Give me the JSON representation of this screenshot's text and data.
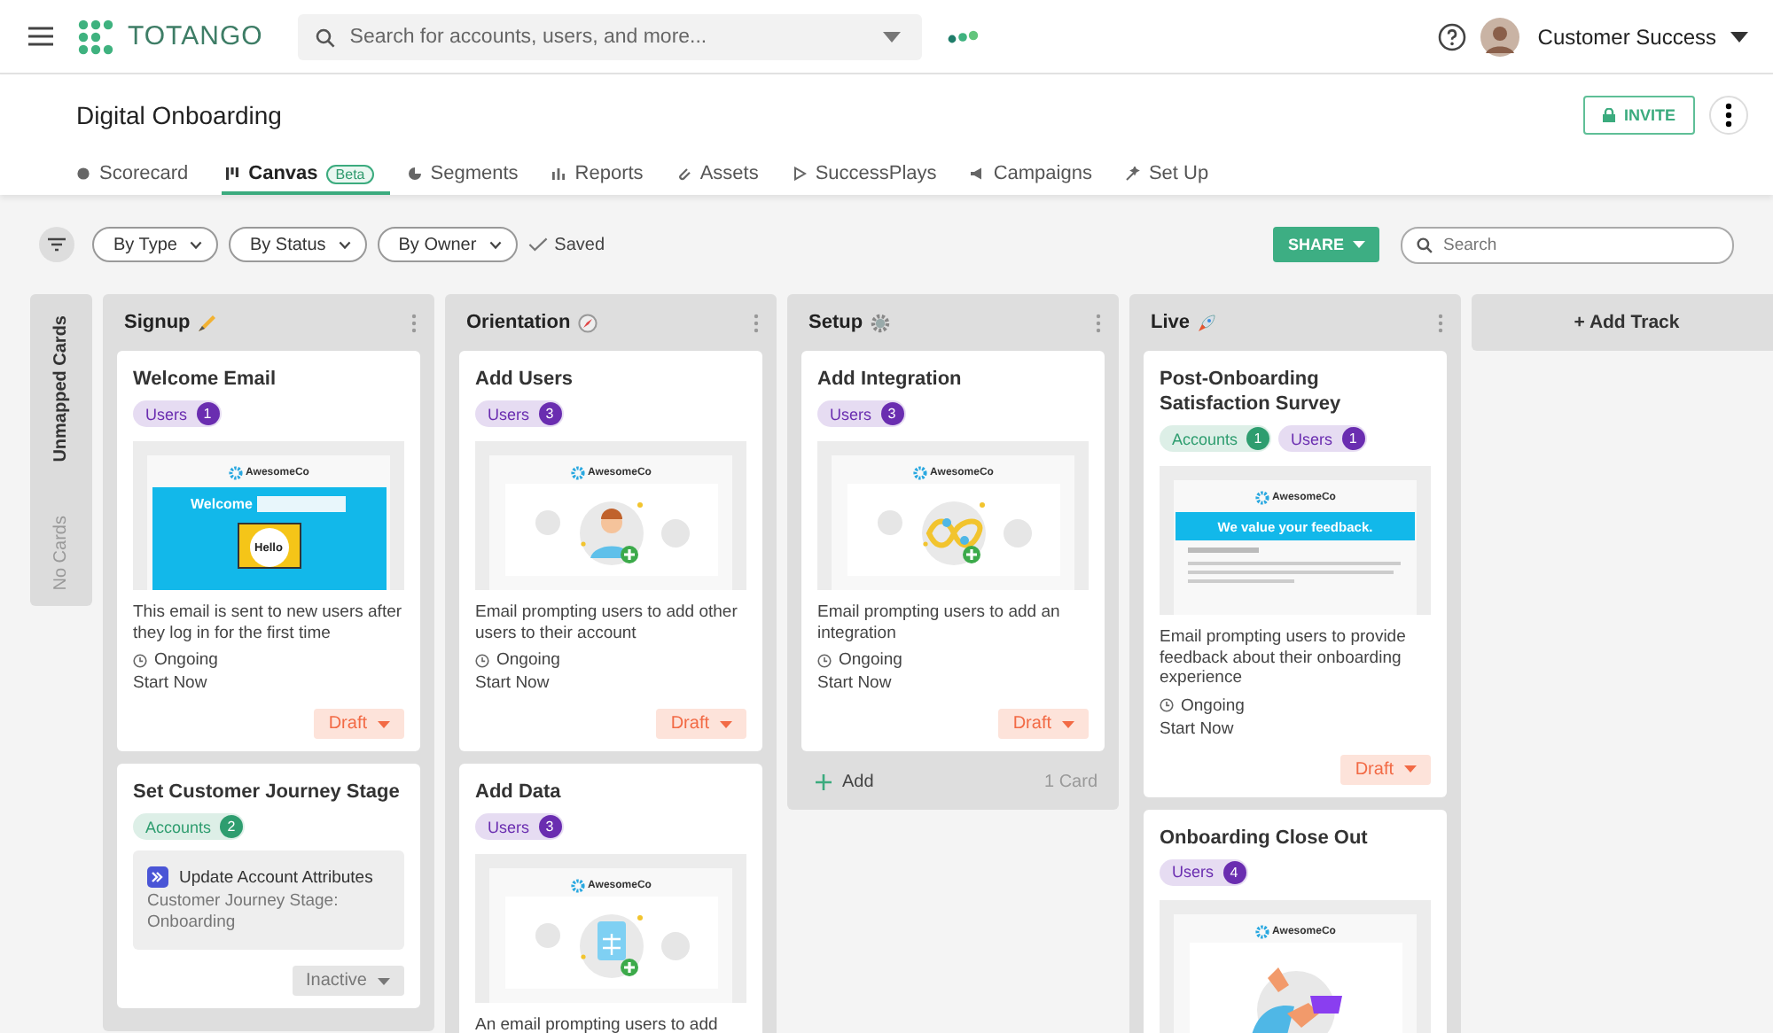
{
  "topbar": {
    "logo": "TOTANGO",
    "search_placeholder": "Search for accounts, users, and more...",
    "user": "Customer Success"
  },
  "page": {
    "title": "Digital Onboarding",
    "invite": "INVITE"
  },
  "tabs": [
    {
      "label": "Scorecard",
      "selected": false
    },
    {
      "label": "Canvas",
      "badge": "Beta",
      "selected": true
    },
    {
      "label": "Segments",
      "selected": false
    },
    {
      "label": "Reports",
      "selected": false
    },
    {
      "label": "Assets",
      "selected": false
    },
    {
      "label": "SuccessPlays",
      "selected": false
    },
    {
      "label": "Campaigns",
      "selected": false
    },
    {
      "label": "Set Up",
      "selected": false
    }
  ],
  "toolbar": {
    "filters": [
      "By Type",
      "By Status",
      "By Owner"
    ],
    "saved": "Saved",
    "share": "SHARE",
    "search_placeholder": "Search"
  },
  "unmapped": {
    "title": "Unmapped Cards",
    "empty": "No Cards"
  },
  "tracks": [
    {
      "title": "Signup",
      "cards": [
        {
          "kind": "email",
          "title": "Welcome Email",
          "tags": [
            {
              "label": "Users",
              "count": "1",
              "color": "#6a2db0"
            }
          ],
          "preview": {
            "kind": "welcome",
            "logo": "AwesomeCo",
            "heading": "Welcome",
            "bubble": "Hello"
          },
          "description": "This email is sent to new users after they log in for the first time",
          "schedule": "Ongoing",
          "start": "Start Now",
          "status": {
            "label": "Draft",
            "kind": "draft"
          }
        },
        {
          "kind": "action",
          "title": "Set Customer Journey Stage",
          "tags": [
            {
              "label": "Accounts",
              "count": "2",
              "color": "#2e9d6f"
            }
          ],
          "action": {
            "title": "Update Account Attributes",
            "detail": "Customer Journey Stage: Onboarding"
          },
          "status": {
            "label": "Inactive",
            "kind": "inactive"
          }
        }
      ]
    },
    {
      "title": "Orientation",
      "cards": [
        {
          "kind": "email",
          "title": "Add Users",
          "tags": [
            {
              "label": "Users",
              "count": "3",
              "color": "#6a2db0"
            }
          ],
          "preview": {
            "kind": "user",
            "logo": "AwesomeCo"
          },
          "description": "Email prompting users to add other users to their account",
          "schedule": "Ongoing",
          "start": "Start Now",
          "status": {
            "label": "Draft",
            "kind": "draft"
          }
        },
        {
          "kind": "email",
          "title": "Add Data",
          "tags": [
            {
              "label": "Users",
              "count": "3",
              "color": "#6a2db0"
            }
          ],
          "preview": {
            "kind": "data",
            "logo": "AwesomeCo"
          },
          "description": "An email prompting users to add"
        }
      ]
    },
    {
      "title": "Setup",
      "cards": [
        {
          "kind": "email",
          "title": "Add Integration",
          "tags": [
            {
              "label": "Users",
              "count": "3",
              "color": "#6a2db0"
            }
          ],
          "preview": {
            "kind": "integration",
            "logo": "AwesomeCo"
          },
          "description": "Email prompting users to add an integration",
          "schedule": "Ongoing",
          "start": "Start Now",
          "status": {
            "label": "Draft",
            "kind": "draft"
          }
        }
      ],
      "footer": {
        "add": "Add",
        "count": "1 Card"
      }
    },
    {
      "title": "Live",
      "cards": [
        {
          "kind": "email",
          "title": "Post-Onboarding Satisfaction Survey",
          "tags": [
            {
              "label": "Accounts",
              "count": "1",
              "color": "#2e9d6f"
            },
            {
              "label": "Users",
              "count": "1",
              "color": "#6a2db0"
            }
          ],
          "preview": {
            "kind": "feedback",
            "logo": "AwesomeCo",
            "heading": "We value your feedback."
          },
          "description": "Email prompting users to provide feedback about their onboarding experience",
          "schedule": "Ongoing",
          "start": "Start Now",
          "status": {
            "label": "Draft",
            "kind": "draft"
          }
        },
        {
          "kind": "email",
          "title": "Onboarding Close Out",
          "tags": [
            {
              "label": "Users",
              "count": "4",
              "color": "#6a2db0"
            }
          ],
          "preview": {
            "kind": "closeout",
            "logo": "AwesomeCo"
          }
        }
      ]
    }
  ],
  "add_track": "+ Add Track"
}
